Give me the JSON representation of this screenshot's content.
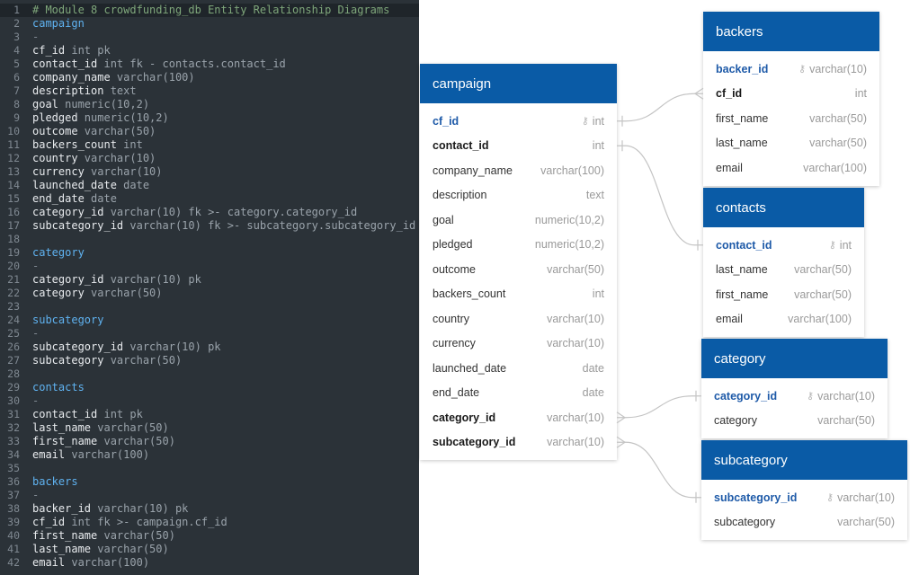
{
  "editor": {
    "lines": [
      {
        "no": "1",
        "parts": [
          {
            "t": "# Module 8 crowdfunding_db Entity Relationship Diagrams",
            "c": "t-comment"
          }
        ]
      },
      {
        "no": "2",
        "parts": [
          {
            "t": "campaign",
            "c": "t-header"
          }
        ]
      },
      {
        "no": "3",
        "parts": [
          {
            "t": "-",
            "c": "t-dash"
          }
        ]
      },
      {
        "no": "4",
        "parts": [
          {
            "t": "cf_id",
            "c": "t-name"
          },
          {
            "t": " int pk",
            "c": "t-type"
          }
        ]
      },
      {
        "no": "5",
        "parts": [
          {
            "t": "contact_id",
            "c": "t-name"
          },
          {
            "t": " int fk - contacts.contact_id",
            "c": "t-type"
          }
        ]
      },
      {
        "no": "6",
        "parts": [
          {
            "t": "company_name",
            "c": "t-name"
          },
          {
            "t": " varchar(100)",
            "c": "t-type"
          }
        ]
      },
      {
        "no": "7",
        "parts": [
          {
            "t": "description",
            "c": "t-name"
          },
          {
            "t": " text",
            "c": "t-type"
          }
        ]
      },
      {
        "no": "8",
        "parts": [
          {
            "t": "goal",
            "c": "t-name"
          },
          {
            "t": " numeric(10,2)",
            "c": "t-type"
          }
        ]
      },
      {
        "no": "9",
        "parts": [
          {
            "t": "pledged",
            "c": "t-name"
          },
          {
            "t": " numeric(10,2)",
            "c": "t-type"
          }
        ]
      },
      {
        "no": "10",
        "parts": [
          {
            "t": "outcome",
            "c": "t-name"
          },
          {
            "t": " varchar(50)",
            "c": "t-type"
          }
        ]
      },
      {
        "no": "11",
        "parts": [
          {
            "t": "backers_count",
            "c": "t-name"
          },
          {
            "t": " int",
            "c": "t-type"
          }
        ]
      },
      {
        "no": "12",
        "parts": [
          {
            "t": "country",
            "c": "t-name"
          },
          {
            "t": " varchar(10)",
            "c": "t-type"
          }
        ]
      },
      {
        "no": "13",
        "parts": [
          {
            "t": "currency",
            "c": "t-name"
          },
          {
            "t": " varchar(10)",
            "c": "t-type"
          }
        ]
      },
      {
        "no": "14",
        "parts": [
          {
            "t": "launched_date",
            "c": "t-name"
          },
          {
            "t": " date",
            "c": "t-type"
          }
        ]
      },
      {
        "no": "15",
        "parts": [
          {
            "t": "end_date",
            "c": "t-name"
          },
          {
            "t": " date",
            "c": "t-type"
          }
        ]
      },
      {
        "no": "16",
        "parts": [
          {
            "t": "category_id",
            "c": "t-name"
          },
          {
            "t": " varchar(10) fk >- category.category_id",
            "c": "t-type"
          }
        ]
      },
      {
        "no": "17",
        "parts": [
          {
            "t": "subcategory_id",
            "c": "t-name"
          },
          {
            "t": " varchar(10) fk >- subcategory.subcategory_id",
            "c": "t-type"
          }
        ]
      },
      {
        "no": "18",
        "parts": []
      },
      {
        "no": "19",
        "parts": [
          {
            "t": "category",
            "c": "t-header"
          }
        ]
      },
      {
        "no": "20",
        "parts": [
          {
            "t": "-",
            "c": "t-dash"
          }
        ]
      },
      {
        "no": "21",
        "parts": [
          {
            "t": "category_id",
            "c": "t-name"
          },
          {
            "t": " varchar(10) pk",
            "c": "t-type"
          }
        ]
      },
      {
        "no": "22",
        "parts": [
          {
            "t": "category",
            "c": "t-name"
          },
          {
            "t": " varchar(50)",
            "c": "t-type"
          }
        ]
      },
      {
        "no": "23",
        "parts": []
      },
      {
        "no": "24",
        "parts": [
          {
            "t": "subcategory",
            "c": "t-header"
          }
        ]
      },
      {
        "no": "25",
        "parts": [
          {
            "t": "-",
            "c": "t-dash"
          }
        ]
      },
      {
        "no": "26",
        "parts": [
          {
            "t": "subcategory_id",
            "c": "t-name"
          },
          {
            "t": " varchar(10) pk",
            "c": "t-type"
          }
        ]
      },
      {
        "no": "27",
        "parts": [
          {
            "t": "subcategory",
            "c": "t-name"
          },
          {
            "t": " varchar(50)",
            "c": "t-type"
          }
        ]
      },
      {
        "no": "28",
        "parts": []
      },
      {
        "no": "29",
        "parts": [
          {
            "t": "contacts",
            "c": "t-header"
          }
        ]
      },
      {
        "no": "30",
        "parts": [
          {
            "t": "-",
            "c": "t-dash"
          }
        ]
      },
      {
        "no": "31",
        "parts": [
          {
            "t": "contact_id",
            "c": "t-name"
          },
          {
            "t": " int pk",
            "c": "t-type"
          }
        ]
      },
      {
        "no": "32",
        "parts": [
          {
            "t": "last_name",
            "c": "t-name"
          },
          {
            "t": " varchar(50)",
            "c": "t-type"
          }
        ]
      },
      {
        "no": "33",
        "parts": [
          {
            "t": "first_name",
            "c": "t-name"
          },
          {
            "t": " varchar(50)",
            "c": "t-type"
          }
        ]
      },
      {
        "no": "34",
        "parts": [
          {
            "t": "email",
            "c": "t-name"
          },
          {
            "t": " varchar(100)",
            "c": "t-type"
          }
        ]
      },
      {
        "no": "35",
        "parts": []
      },
      {
        "no": "36",
        "parts": [
          {
            "t": "backers",
            "c": "t-header"
          }
        ]
      },
      {
        "no": "37",
        "parts": [
          {
            "t": "-",
            "c": "t-dash"
          }
        ]
      },
      {
        "no": "38",
        "parts": [
          {
            "t": "backer_id",
            "c": "t-name"
          },
          {
            "t": " varchar(10) pk",
            "c": "t-type"
          }
        ]
      },
      {
        "no": "39",
        "parts": [
          {
            "t": "cf_id",
            "c": "t-name"
          },
          {
            "t": " int fk >- campaign.cf_id",
            "c": "t-type"
          }
        ]
      },
      {
        "no": "40",
        "parts": [
          {
            "t": "first_name",
            "c": "t-name"
          },
          {
            "t": " varchar(50)",
            "c": "t-type"
          }
        ]
      },
      {
        "no": "41",
        "parts": [
          {
            "t": "last_name",
            "c": "t-name"
          },
          {
            "t": " varchar(50)",
            "c": "t-type"
          }
        ]
      },
      {
        "no": "42",
        "parts": [
          {
            "t": "email",
            "c": "t-name"
          },
          {
            "t": " varchar(100)",
            "c": "t-type"
          }
        ]
      }
    ]
  },
  "tables": [
    {
      "id": "campaign",
      "title": "campaign",
      "rows": [
        {
          "name": "cf_id",
          "type": "int",
          "role": "pk"
        },
        {
          "name": "contact_id",
          "type": "int",
          "role": "key"
        },
        {
          "name": "company_name",
          "type": "varchar(100)",
          "role": ""
        },
        {
          "name": "description",
          "type": "text",
          "role": ""
        },
        {
          "name": "goal",
          "type": "numeric(10,2)",
          "role": ""
        },
        {
          "name": "pledged",
          "type": "numeric(10,2)",
          "role": ""
        },
        {
          "name": "outcome",
          "type": "varchar(50)",
          "role": ""
        },
        {
          "name": "backers_count",
          "type": "int",
          "role": ""
        },
        {
          "name": "country",
          "type": "varchar(10)",
          "role": ""
        },
        {
          "name": "currency",
          "type": "varchar(10)",
          "role": ""
        },
        {
          "name": "launched_date",
          "type": "date",
          "role": ""
        },
        {
          "name": "end_date",
          "type": "date",
          "role": ""
        },
        {
          "name": "category_id",
          "type": "varchar(10)",
          "role": "key"
        },
        {
          "name": "subcategory_id",
          "type": "varchar(10)",
          "role": "key"
        }
      ]
    },
    {
      "id": "backers",
      "title": "backers",
      "rows": [
        {
          "name": "backer_id",
          "type": "varchar(10)",
          "role": "pk"
        },
        {
          "name": "cf_id",
          "type": "int",
          "role": "key"
        },
        {
          "name": "first_name",
          "type": "varchar(50)",
          "role": ""
        },
        {
          "name": "last_name",
          "type": "varchar(50)",
          "role": ""
        },
        {
          "name": "email",
          "type": "varchar(100)",
          "role": ""
        }
      ]
    },
    {
      "id": "contacts",
      "title": "contacts",
      "rows": [
        {
          "name": "contact_id",
          "type": "int",
          "role": "pk"
        },
        {
          "name": "last_name",
          "type": "varchar(50)",
          "role": ""
        },
        {
          "name": "first_name",
          "type": "varchar(50)",
          "role": ""
        },
        {
          "name": "email",
          "type": "varchar(100)",
          "role": ""
        }
      ]
    },
    {
      "id": "category",
      "title": "category",
      "rows": [
        {
          "name": "category_id",
          "type": "varchar(10)",
          "role": "pk"
        },
        {
          "name": "category",
          "type": "varchar(50)",
          "role": ""
        }
      ]
    },
    {
      "id": "subcategory",
      "title": "subcategory",
      "rows": [
        {
          "name": "subcategory_id",
          "type": "varchar(10)",
          "role": "pk"
        },
        {
          "name": "subcategory",
          "type": "varchar(50)",
          "role": ""
        }
      ]
    }
  ],
  "relationships": [
    {
      "from": "campaign.cf_id",
      "to": "backers.cf_id",
      "from_end": "one",
      "to_end": "many"
    },
    {
      "from": "campaign.contact_id",
      "to": "contacts.contact_id",
      "from_end": "one",
      "to_end": "one"
    },
    {
      "from": "campaign.category_id",
      "to": "category.category_id",
      "from_end": "many",
      "to_end": "one"
    },
    {
      "from": "campaign.subcategory_id",
      "to": "subcategory.subcategory_id",
      "from_end": "many",
      "to_end": "one"
    }
  ],
  "icons": {
    "primary_key": "key-icon"
  },
  "colors": {
    "header_bg": "#0a5ba6",
    "editor_bg": "#2b3238",
    "editor_header": "#5fb2f0",
    "editor_comment": "#7fa77b",
    "pk_text": "#1e5aa8"
  }
}
